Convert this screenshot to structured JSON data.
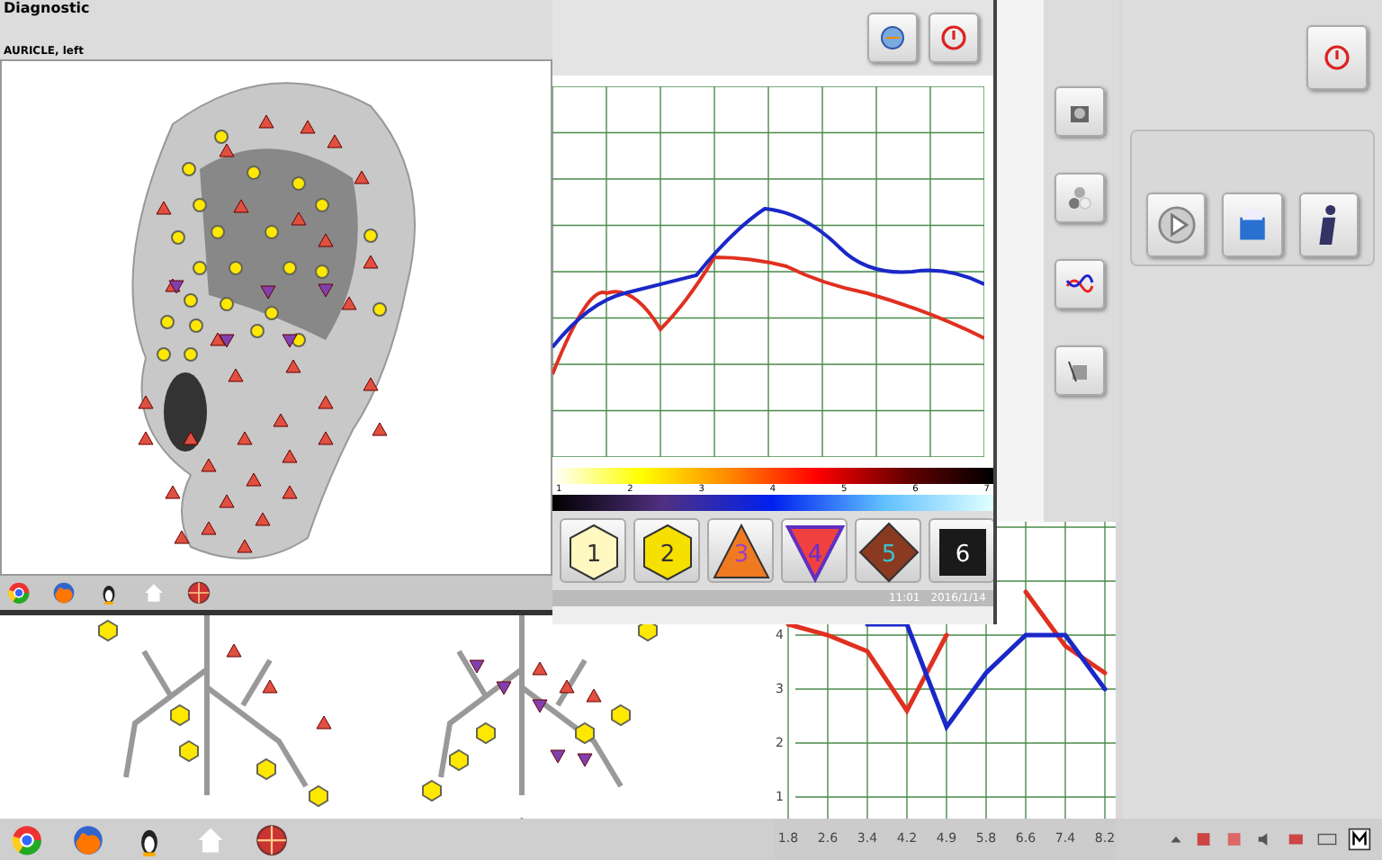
{
  "ear_window": {
    "title": "Diagnostic",
    "subtitle": "AURICLE, left"
  },
  "chart_window": {
    "scale_labels": [
      "1",
      "2",
      "3",
      "4",
      "5",
      "6",
      "7"
    ],
    "legend": [
      {
        "label": "1",
        "kind": "hexagon",
        "color": "#fff8c0"
      },
      {
        "label": "2",
        "kind": "hexagon",
        "color": "#f5e000"
      },
      {
        "label": "3",
        "kind": "triangle",
        "color": "#f07a20"
      },
      {
        "label": "4",
        "kind": "inverted",
        "color": "#f04040"
      },
      {
        "label": "5",
        "kind": "diamond",
        "color": "#8a3a20"
      },
      {
        "label": "6",
        "kind": "square",
        "color": "#1a1a1a"
      }
    ],
    "clock": {
      "time": "11:01",
      "date": "2016/1/14"
    }
  },
  "lower_chart": {
    "chart_data": {
      "type": "line",
      "categories": [
        "1.8",
        "2.6",
        "3.4",
        "4.2",
        "4.9",
        "5.8",
        "6.6",
        "7.4",
        "8.2"
      ],
      "series": [
        {
          "color": "#e03020",
          "values": [
            4.2,
            4.0,
            3.7,
            2.6,
            4.0,
            null,
            4.8,
            3.8,
            3.3
          ]
        },
        {
          "color": "#1a28c8",
          "values": [
            null,
            null,
            4.2,
            4.2,
            2.3,
            3.3,
            4.0,
            4.0,
            3.0
          ]
        }
      ],
      "ylim": [
        0.6,
        6.1
      ],
      "yticks": [
        1,
        2,
        3,
        4
      ],
      "grid": true
    }
  }
}
